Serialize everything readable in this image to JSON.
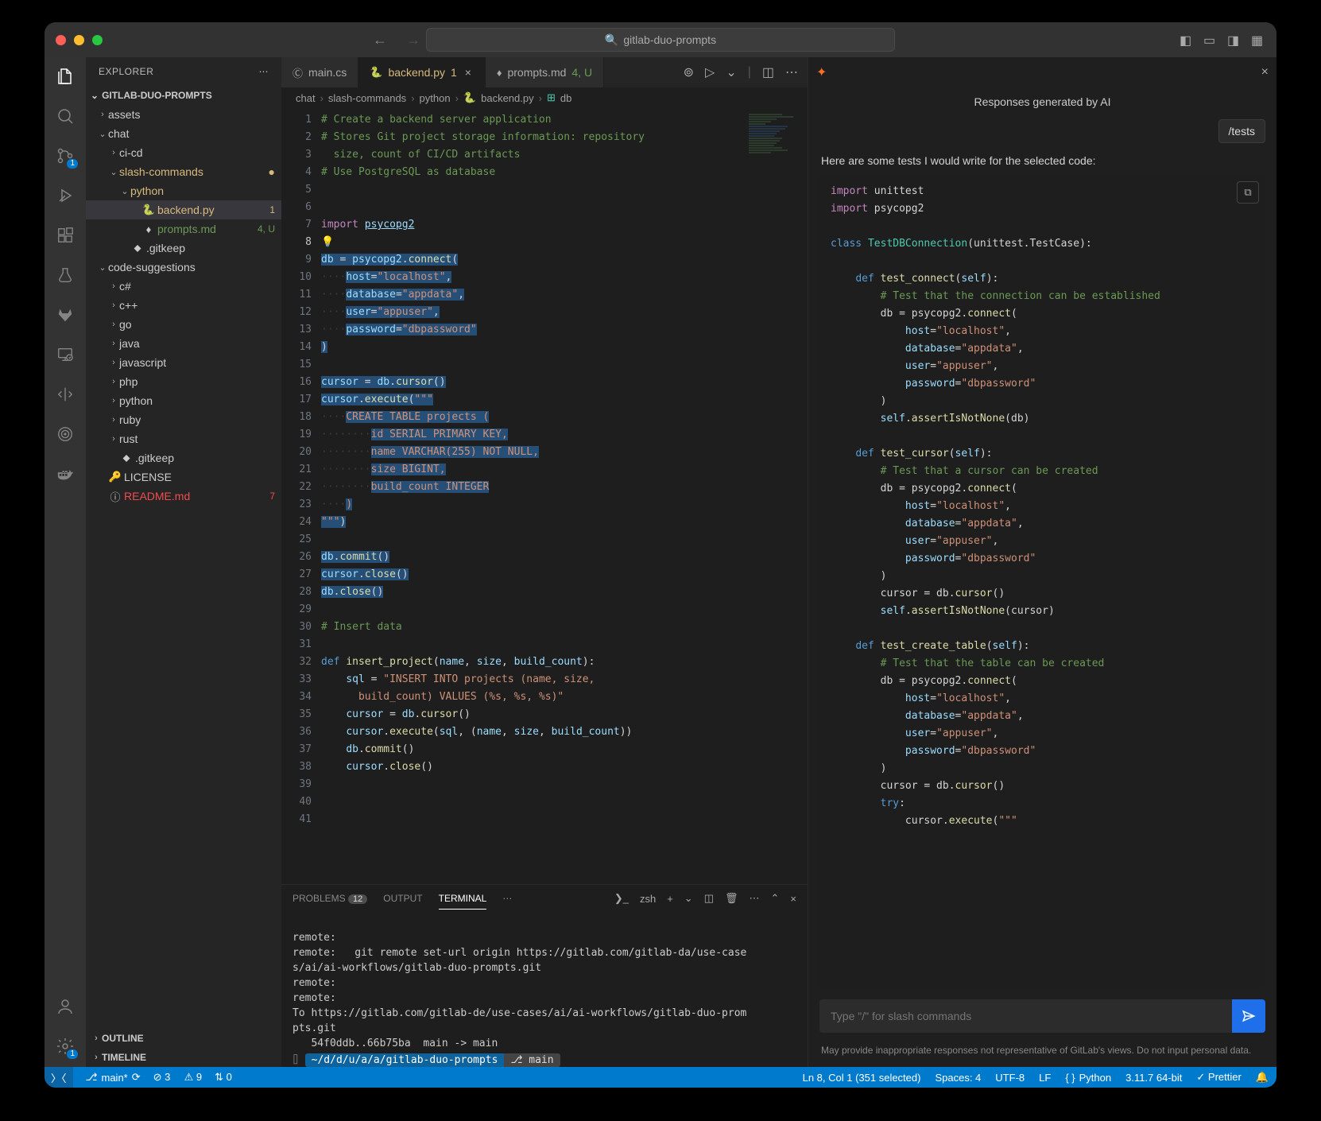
{
  "title": "gitlab-duo-prompts",
  "explorer": {
    "header": "EXPLORER",
    "project": "GITLAB-DUO-PROMPTS",
    "outline": "OUTLINE",
    "timeline": "TIMELINE"
  },
  "tree": [
    {
      "pad": 14,
      "chev": "›",
      "name": "assets",
      "cls": ""
    },
    {
      "pad": 14,
      "chev": "⌄",
      "name": "chat",
      "cls": ""
    },
    {
      "pad": 28,
      "chev": "›",
      "name": "ci-cd",
      "cls": ""
    },
    {
      "pad": 28,
      "chev": "⌄",
      "name": "slash-commands",
      "cls": "mod",
      "dot": true
    },
    {
      "pad": 42,
      "chev": "⌄",
      "name": "python",
      "cls": "mod"
    },
    {
      "pad": 56,
      "chev": "",
      "ico": "🐍",
      "name": "backend.py",
      "cls": "mod sel",
      "deco": "1"
    },
    {
      "pad": 56,
      "chev": "",
      "ico": "♦",
      "name": "prompts.md",
      "cls": "unt",
      "deco": "4, U"
    },
    {
      "pad": 42,
      "chev": "",
      "ico": "⬥",
      "name": ".gitkeep",
      "cls": ""
    },
    {
      "pad": 14,
      "chev": "⌄",
      "name": "code-suggestions",
      "cls": ""
    },
    {
      "pad": 28,
      "chev": "›",
      "name": "c#",
      "cls": ""
    },
    {
      "pad": 28,
      "chev": "›",
      "name": "c++",
      "cls": ""
    },
    {
      "pad": 28,
      "chev": "›",
      "name": "go",
      "cls": ""
    },
    {
      "pad": 28,
      "chev": "›",
      "name": "java",
      "cls": ""
    },
    {
      "pad": 28,
      "chev": "›",
      "name": "javascript",
      "cls": ""
    },
    {
      "pad": 28,
      "chev": "›",
      "name": "php",
      "cls": ""
    },
    {
      "pad": 28,
      "chev": "›",
      "name": "python",
      "cls": ""
    },
    {
      "pad": 28,
      "chev": "›",
      "name": "ruby",
      "cls": ""
    },
    {
      "pad": 28,
      "chev": "›",
      "name": "rust",
      "cls": ""
    },
    {
      "pad": 28,
      "chev": "",
      "ico": "⬥",
      "name": ".gitkeep",
      "cls": ""
    },
    {
      "pad": 14,
      "chev": "",
      "ico": "🔑",
      "name": "LICENSE",
      "cls": ""
    },
    {
      "pad": 14,
      "chev": "",
      "ico": "ⓘ",
      "name": "README.md",
      "cls": "err",
      "deco": "7"
    }
  ],
  "tabs": [
    {
      "ico": "Ⓒ",
      "label": "main.cs",
      "cls": "",
      "deco": ""
    },
    {
      "ico": "🐍",
      "label": "backend.py",
      "cls": "active mod",
      "deco": "1",
      "close": "×"
    },
    {
      "ico": "♦",
      "label": "prompts.md",
      "cls": "unt",
      "deco": "4, U"
    }
  ],
  "breadcrumbs": [
    "chat",
    "slash-commands",
    "python",
    "backend.py",
    "db"
  ],
  "editor": {
    "lines": [
      {
        "n": 1,
        "h": "<span class='c'># Create a backend server application</span>"
      },
      {
        "n": 2,
        "h": "<span class='c'># Stores Git project storage information: repository</span>"
      },
      {
        "n": "",
        "h": "<span class='c'>  size, count of CI/CD artifacts</span>"
      },
      {
        "n": 3,
        "h": "<span class='c'># Use PostgreSQL as database</span>"
      },
      {
        "n": 4,
        "h": ""
      },
      {
        "n": 5,
        "h": ""
      },
      {
        "n": 6,
        "h": "<span class='kd'>import</span> <span class='v' style='text-decoration:underline'>psycopg2</span>"
      },
      {
        "n": 7,
        "h": "💡"
      },
      {
        "n": 8,
        "cl": true,
        "h": "<span class='hl'><span class='v'>db</span> = <span class='v'>psycopg2</span>.<span class='f'>connect</span>(</span>"
      },
      {
        "n": 9,
        "h": "<span class='ws'>····</span><span class='hl'><span class='v'>host</span>=<span class='s'>\"localhost\"</span>,</span>"
      },
      {
        "n": 10,
        "h": "<span class='ws'>····</span><span class='hl'><span class='v'>database</span>=<span class='s'>\"appdata\"</span>,</span>"
      },
      {
        "n": 11,
        "h": "<span class='ws'>····</span><span class='hl'><span class='v'>user</span>=<span class='s'>\"appuser\"</span>,</span>"
      },
      {
        "n": 12,
        "h": "<span class='ws'>····</span><span class='hl'><span class='v'>password</span>=<span class='s'>\"dbpassword\"</span></span>"
      },
      {
        "n": 13,
        "h": "<span class='hl'>)</span>"
      },
      {
        "n": 14,
        "h": ""
      },
      {
        "n": 15,
        "h": "<span class='hl'><span class='v'>cursor</span> = <span class='v'>db</span>.<span class='f'>cursor</span>()</span>"
      },
      {
        "n": 16,
        "h": "<span class='hl'><span class='v'>cursor</span>.<span class='f'>execute</span>(<span class='s'>\"\"\"</span></span>"
      },
      {
        "n": 17,
        "h": "<span class='ws'>····</span><span class='hl'><span class='s'>CREATE TABLE projects (</span></span>"
      },
      {
        "n": 18,
        "h": "<span class='ws'>········</span><span class='hl'><span class='s'>id SERIAL PRIMARY KEY,</span></span>"
      },
      {
        "n": 19,
        "h": "<span class='ws'>········</span><span class='hl'><span class='s'>name VARCHAR(255) NOT NULL,</span></span>"
      },
      {
        "n": 20,
        "h": "<span class='ws'>········</span><span class='hl'><span class='s'>size BIGINT,</span></span>"
      },
      {
        "n": 21,
        "h": "<span class='ws'>········</span><span class='hl'><span class='s'>build_count INTEGER</span></span>"
      },
      {
        "n": 22,
        "h": "<span class='ws'>····</span><span class='hl'><span class='s'>)</span></span>"
      },
      {
        "n": 23,
        "h": "<span class='hl'><span class='s'>\"\"\"</span>)</span>"
      },
      {
        "n": 24,
        "h": ""
      },
      {
        "n": 25,
        "h": "<span class='hl'><span class='v'>db</span>.<span class='f'>commit</span>()</span>"
      },
      {
        "n": 26,
        "h": "<span class='hl'><span class='v'>cursor</span>.<span class='f'>close</span>()</span>"
      },
      {
        "n": 27,
        "h": "<span class='hl'><span class='v'>db</span>.<span class='f'>close</span>()</span>"
      },
      {
        "n": 28,
        "h": ""
      },
      {
        "n": 29,
        "h": "<span class='c'># Insert data</span>"
      },
      {
        "n": 30,
        "h": ""
      },
      {
        "n": 31,
        "h": "<span class='k'>def</span> <span class='f'>insert_project</span>(<span class='v'>name</span>, <span class='v'>size</span>, <span class='v'>build_count</span>):"
      },
      {
        "n": 32,
        "h": "    <span class='v'>sql</span> = <span class='s'>\"INSERT INTO projects (name, size,</span>"
      },
      {
        "n": "",
        "h": "    <span class='s'>  build_count) VALUES (%s, %s, %s)\"</span>"
      },
      {
        "n": 33,
        "h": "    <span class='v'>cursor</span> = <span class='v'>db</span>.<span class='f'>cursor</span>()"
      },
      {
        "n": 34,
        "h": "    <span class='v'>cursor</span>.<span class='f'>execute</span>(<span class='v'>sql</span>, (<span class='v'>name</span>, <span class='v'>size</span>, <span class='v'>build_count</span>))"
      },
      {
        "n": 35,
        "h": "    <span class='v'>db</span>.<span class='f'>commit</span>()"
      },
      {
        "n": 36,
        "h": "    <span class='v'>cursor</span>.<span class='f'>close</span>()"
      },
      {
        "n": 37,
        "h": ""
      },
      {
        "n": 38,
        "h": ""
      },
      {
        "n": 39,
        "h": ""
      },
      {
        "n": 40,
        "h": ""
      },
      {
        "n": 41,
        "h": ""
      }
    ]
  },
  "panel": {
    "tabs": {
      "problems": "PROBLEMS",
      "problems_count": "12",
      "output": "OUTPUT",
      "terminal": "TERMINAL"
    },
    "shell": "zsh",
    "term_body": "remote:\nremote:   git remote set-url origin https://gitlab.com/gitlab-da/use-case\ns/ai/ai-workflows/gitlab-duo-prompts.git\nremote:\nremote:\nTo https://gitlab.com/gitlab-de/use-cases/ai/ai-workflows/gitlab-duo-prom\npts.git\n   54f0ddb..66b75ba  main -> main",
    "term_path": "~/d/d/u/a/a/gitlab-duo-prompts",
    "term_branch": "⎇ main"
  },
  "ai": {
    "title": "Responses generated by AI",
    "chip": "/tests",
    "msg": "Here are some tests I would write for the selected code:",
    "code": "<span class='kd'>import</span> unittest\n<span class='kd'>import</span> psycopg2\n\n<span class='k'>class</span> <span class='cl'>TestDBConnection</span>(unittest.TestCase):\n\n    <span class='k'>def</span> <span class='f'>test_connect</span>(<span class='v'>self</span>):\n        <span class='c'># Test that the connection can be established</span>\n        db = psycopg2.<span class='f'>connect</span>(\n            <span class='v'>host</span>=<span class='s'>\"localhost\"</span>,\n            <span class='v'>database</span>=<span class='s'>\"appdata\"</span>,\n            <span class='v'>user</span>=<span class='s'>\"appuser\"</span>,\n            <span class='v'>password</span>=<span class='s'>\"dbpassword\"</span>\n        )\n        <span class='v'>self</span>.<span class='f'>assertIsNotNone</span>(db)\n\n    <span class='k'>def</span> <span class='f'>test_cursor</span>(<span class='v'>self</span>):\n        <span class='c'># Test that a cursor can be created</span>\n        db = psycopg2.<span class='f'>connect</span>(\n            <span class='v'>host</span>=<span class='s'>\"localhost\"</span>,\n            <span class='v'>database</span>=<span class='s'>\"appdata\"</span>,\n            <span class='v'>user</span>=<span class='s'>\"appuser\"</span>,\n            <span class='v'>password</span>=<span class='s'>\"dbpassword\"</span>\n        )\n        cursor = db.<span class='f'>cursor</span>()\n        <span class='v'>self</span>.<span class='f'>assertIsNotNone</span>(cursor)\n\n    <span class='k'>def</span> <span class='f'>test_create_table</span>(<span class='v'>self</span>):\n        <span class='c'># Test that the table can be created</span>\n        db = psycopg2.<span class='f'>connect</span>(\n            <span class='v'>host</span>=<span class='s'>\"localhost\"</span>,\n            <span class='v'>database</span>=<span class='s'>\"appdata\"</span>,\n            <span class='v'>user</span>=<span class='s'>\"appuser\"</span>,\n            <span class='v'>password</span>=<span class='s'>\"dbpassword\"</span>\n        )\n        cursor = db.<span class='f'>cursor</span>()\n        <span class='k'>try</span>:\n            cursor.<span class='f'>execute</span>(<span class='s'>\"\"\"</span>",
    "placeholder": "Type \"/\" for slash commands",
    "disclaim": "May provide inappropriate responses not representative of GitLab's views. Do not input personal data."
  },
  "status": {
    "branch": "main*",
    "sync": "⟳",
    "err": "⊘ 3",
    "warn": "⚠ 9",
    "port": "⇅ 0",
    "pos": "Ln 8, Col 1 (351 selected)",
    "spaces": "Spaces: 4",
    "enc": "UTF-8",
    "eol": "LF",
    "lang": "Python",
    "py": "3.11.7 64-bit",
    "prettier": "✓ Prettier"
  },
  "activity_badges": {
    "scm": "1",
    "settings": "1"
  }
}
